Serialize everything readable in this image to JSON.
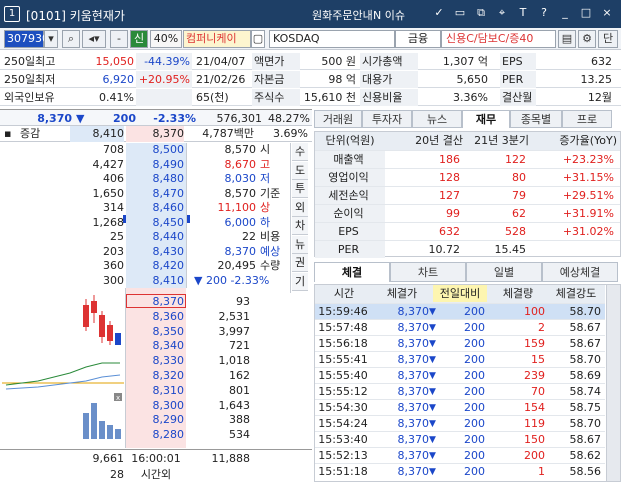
{
  "window": {
    "num": "1",
    "title": "[0101] 키움현재가",
    "order_menu": "원화주문안내",
    "news_label": "N 이슈"
  },
  "toolbar": {
    "code": "307930",
    "sin": "신",
    "margin": "40%",
    "name": "컴퍼니케이",
    "market": "KOSDAQ",
    "sector": "금융",
    "credit": "신용C/담보C/증40",
    "page_btn": "단"
  },
  "info": [
    [
      {
        "t": "250일최고",
        "c": ""
      },
      {
        "t": "15,050",
        "c": "red"
      },
      {
        "t": "-44.39%",
        "c": "blue"
      },
      {
        "t": "21/04/07",
        "c": ""
      },
      {
        "t": "액면가",
        "c": ""
      },
      {
        "t": "500 원",
        "c": ""
      },
      {
        "t": "시가총액",
        "c": ""
      },
      {
        "t": "1,307 억",
        "c": ""
      },
      {
        "t": "EPS",
        "c": ""
      },
      {
        "t": "632",
        "c": ""
      }
    ],
    [
      {
        "t": "250일최저",
        "c": ""
      },
      {
        "t": "6,920",
        "c": "blue"
      },
      {
        "t": "+20.95%",
        "c": "red"
      },
      {
        "t": "21/02/26",
        "c": ""
      },
      {
        "t": "자본금",
        "c": ""
      },
      {
        "t": "98 억",
        "c": ""
      },
      {
        "t": "대용가",
        "c": ""
      },
      {
        "t": "5,650",
        "c": ""
      },
      {
        "t": "PER",
        "c": ""
      },
      {
        "t": "13.25",
        "c": ""
      }
    ],
    [
      {
        "t": "외국인보유",
        "c": ""
      },
      {
        "t": "0.41%",
        "c": ""
      },
      {
        "t": "",
        "c": ""
      },
      {
        "t": "65(천)",
        "c": ""
      },
      {
        "t": "주식수",
        "c": ""
      },
      {
        "t": "15,610 천",
        "c": ""
      },
      {
        "t": "신용비율",
        "c": ""
      },
      {
        "t": "3.36%",
        "c": ""
      },
      {
        "t": "결산월",
        "c": ""
      },
      {
        "t": "12월",
        "c": ""
      }
    ]
  ],
  "price": {
    "cur": "8,370",
    "arrow": "▼",
    "diff": "200",
    "rate": "-2.33%",
    "volume": "576,301",
    "vol_rate": "48.27%"
  },
  "ob_head": {
    "label": "증감",
    "sell_total": "8,410",
    "price": "8,370",
    "amt": "4,787백만",
    "rate": "3.69%"
  },
  "sell_orders": [
    {
      "qty": "708",
      "price": "8,500"
    },
    {
      "qty": "4,427",
      "price": "8,490"
    },
    {
      "qty": "406",
      "price": "8,480"
    },
    {
      "qty": "1,650",
      "price": "8,470"
    },
    {
      "qty": "314",
      "price": "8,460"
    },
    {
      "qty": "1,268",
      "price": "8,450"
    },
    {
      "qty": "25",
      "price": "8,440"
    },
    {
      "qty": "203",
      "price": "8,430"
    },
    {
      "qty": "360",
      "price": "8,420"
    },
    {
      "qty": "300",
      "price": "8,410"
    }
  ],
  "buy_orders": [
    {
      "price": "8,370",
      "qty": "93"
    },
    {
      "price": "8,360",
      "qty": "2,531"
    },
    {
      "price": "8,350",
      "qty": "3,997"
    },
    {
      "price": "8,340",
      "qty": "721"
    },
    {
      "price": "8,330",
      "qty": "1,018"
    },
    {
      "price": "8,320",
      "qty": "162"
    },
    {
      "price": "8,310",
      "qty": "801"
    },
    {
      "price": "8,300",
      "qty": "1,643"
    },
    {
      "price": "8,290",
      "qty": "388"
    },
    {
      "price": "8,280",
      "qty": "534"
    }
  ],
  "stats": [
    {
      "v": "8,570",
      "l": "시",
      "c": ""
    },
    {
      "v": "8,670",
      "l": "고",
      "c": "red"
    },
    {
      "v": "8,030",
      "l": "저",
      "c": "blue"
    },
    {
      "v": "8,570",
      "l": "기준",
      "c": ""
    },
    {
      "v": "11,100",
      "l": "상",
      "c": "red"
    },
    {
      "v": "6,000",
      "l": "하",
      "c": "blue"
    },
    {
      "v": "22",
      "l": "비용",
      "c": ""
    },
    {
      "v": "8,370",
      "l": "예상",
      "c": "blue"
    },
    {
      "v": "20,495",
      "l": "수량",
      "c": ""
    },
    {
      "v": "▼ 200 -2.33%",
      "l": "",
      "c": "blue"
    }
  ],
  "side_tabs": [
    "수",
    "도",
    "투",
    "외",
    "차",
    "뉴",
    "권",
    "기"
  ],
  "ob_foot": {
    "sell_sum": "9,661",
    "time": "16:00:01",
    "buy_sum": "11,888",
    "after_qty": "28",
    "after_label": "시간외"
  },
  "fin_tabs": [
    "거래원",
    "투자자",
    "뉴스",
    "재무",
    "종목별",
    "프로"
  ],
  "fin_head": [
    "단위(억원)",
    "20년 결산",
    "21년 3분기",
    "증가율(YoY)"
  ],
  "fin_rows": [
    {
      "n": "매출액",
      "a": "186",
      "b": "122",
      "g": "+23.23%"
    },
    {
      "n": "영업이익",
      "a": "128",
      "b": "80",
      "g": "+31.15%"
    },
    {
      "n": "세전손익",
      "a": "127",
      "b": "79",
      "g": "+29.51%"
    },
    {
      "n": "순이익",
      "a": "99",
      "b": "62",
      "g": "+31.91%"
    },
    {
      "n": "EPS",
      "a": "632",
      "b": "528",
      "g": "+31.02%"
    },
    {
      "n": "PER",
      "a": "10.72",
      "b": "15.45",
      "g": ""
    }
  ],
  "trade_tabs": [
    "체결",
    "차트",
    "일별",
    "예상체결"
  ],
  "trade_head": [
    "시간",
    "체결가",
    "전일대비",
    "체결량",
    "체결강도"
  ],
  "trades": [
    {
      "t": "15:59:46",
      "p": "8,370",
      "d": "200",
      "q": "100",
      "s": "58.70"
    },
    {
      "t": "15:57:48",
      "p": "8,370",
      "d": "200",
      "q": "2",
      "s": "58.67"
    },
    {
      "t": "15:56:18",
      "p": "8,370",
      "d": "200",
      "q": "159",
      "s": "58.67"
    },
    {
      "t": "15:55:41",
      "p": "8,370",
      "d": "200",
      "q": "15",
      "s": "58.70"
    },
    {
      "t": "15:55:40",
      "p": "8,370",
      "d": "200",
      "q": "239",
      "s": "58.69"
    },
    {
      "t": "15:55:12",
      "p": "8,370",
      "d": "200",
      "q": "70",
      "s": "58.74"
    },
    {
      "t": "15:54:30",
      "p": "8,370",
      "d": "200",
      "q": "154",
      "s": "58.75"
    },
    {
      "t": "15:54:24",
      "p": "8,370",
      "d": "200",
      "q": "119",
      "s": "58.70"
    },
    {
      "t": "15:53:40",
      "p": "8,370",
      "d": "200",
      "q": "150",
      "s": "58.67"
    },
    {
      "t": "15:52:13",
      "p": "8,370",
      "d": "200",
      "q": "200",
      "s": "58.62"
    },
    {
      "t": "15:51:18",
      "p": "8,370",
      "d": "200",
      "q": "1",
      "s": "58.56"
    }
  ]
}
